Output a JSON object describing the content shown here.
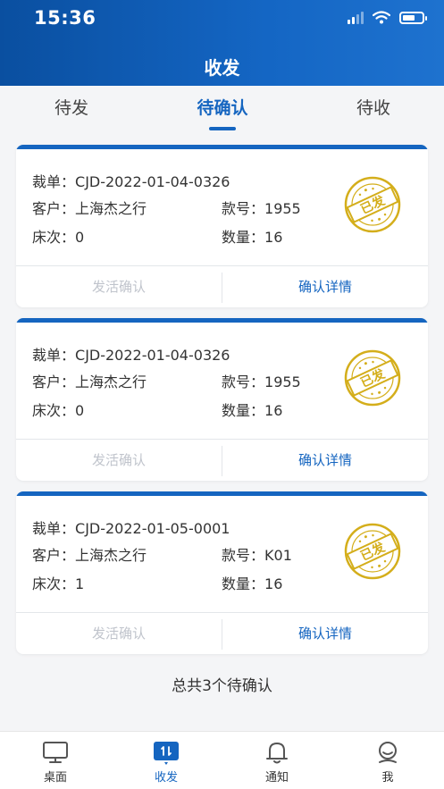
{
  "status_bar": {
    "time": "15:36"
  },
  "header": {
    "title": "收发"
  },
  "tabs": [
    {
      "label": "待发",
      "active": false
    },
    {
      "label": "待确认",
      "active": true
    },
    {
      "label": "待收",
      "active": false
    }
  ],
  "colors": {
    "primary": "#1565c0",
    "stamp": "#d4ae1b",
    "disabled_text": "#c0c4cc"
  },
  "cards": [
    {
      "cut_label": "裁单：",
      "cut_value": "CJD-2022-01-04-0326",
      "customer_label": "客户：",
      "customer_value": "上海杰之行",
      "style_label": "款号：",
      "style_value": "1955",
      "bed_label": "床次：",
      "bed_value": "0",
      "qty_label": "数量：",
      "qty_value": "16",
      "stamp_text": "已发",
      "confirm_button": "发活确认",
      "detail_button": "确认详情"
    },
    {
      "cut_label": "裁单：",
      "cut_value": "CJD-2022-01-04-0326",
      "customer_label": "客户：",
      "customer_value": "上海杰之行",
      "style_label": "款号：",
      "style_value": "1955",
      "bed_label": "床次：",
      "bed_value": "0",
      "qty_label": "数量：",
      "qty_value": "16",
      "stamp_text": "已发",
      "confirm_button": "发活确认",
      "detail_button": "确认详情"
    },
    {
      "cut_label": "裁单：",
      "cut_value": "CJD-2022-01-05-0001",
      "customer_label": "客户：",
      "customer_value": "上海杰之行",
      "style_label": "款号：",
      "style_value": "K01",
      "bed_label": "床次：",
      "bed_value": "1",
      "qty_label": "数量：",
      "qty_value": "16",
      "stamp_text": "已发",
      "confirm_button": "发活确认",
      "detail_button": "确认详情"
    }
  ],
  "summary": {
    "total_text": "总共3个待确认"
  },
  "bottom_nav": [
    {
      "label": "桌面",
      "icon": "desktop-icon",
      "active": false
    },
    {
      "label": "收发",
      "icon": "transfer-icon",
      "active": true
    },
    {
      "label": "通知",
      "icon": "bell-icon",
      "active": false
    },
    {
      "label": "我",
      "icon": "user-icon",
      "active": false
    }
  ]
}
